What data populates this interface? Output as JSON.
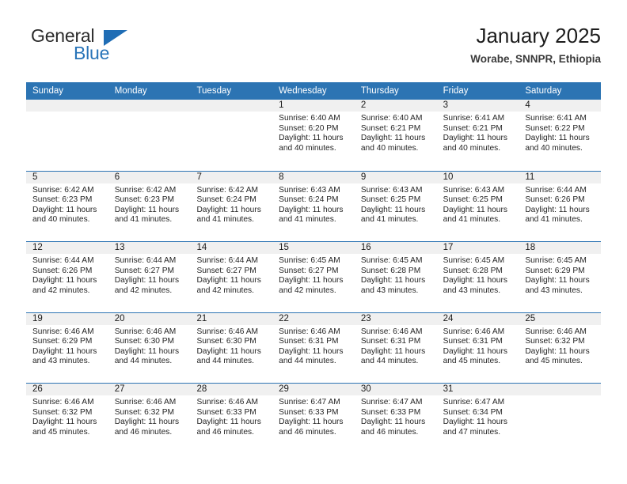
{
  "brand": {
    "name_part1": "General",
    "name_part2": "Blue",
    "flag_icon": "triangle-flag-icon"
  },
  "header": {
    "title": "January 2025",
    "subtitle": "Worabe, SNNPR, Ethiopia"
  },
  "colors": {
    "header_blue": "#2c74b3",
    "brand_blue": "#2874b8",
    "shade_gray": "#f0f0f0"
  },
  "calendar": {
    "weekdays": [
      "Sunday",
      "Monday",
      "Tuesday",
      "Wednesday",
      "Thursday",
      "Friday",
      "Saturday"
    ],
    "weeks": [
      {
        "shaded": true,
        "days": [
          {
            "num": "",
            "sunrise": "",
            "sunset": "",
            "daylight1": "",
            "daylight2": ""
          },
          {
            "num": "",
            "sunrise": "",
            "sunset": "",
            "daylight1": "",
            "daylight2": ""
          },
          {
            "num": "",
            "sunrise": "",
            "sunset": "",
            "daylight1": "",
            "daylight2": ""
          },
          {
            "num": "1",
            "sunrise": "Sunrise: 6:40 AM",
            "sunset": "Sunset: 6:20 PM",
            "daylight1": "Daylight: 11 hours",
            "daylight2": "and 40 minutes."
          },
          {
            "num": "2",
            "sunrise": "Sunrise: 6:40 AM",
            "sunset": "Sunset: 6:21 PM",
            "daylight1": "Daylight: 11 hours",
            "daylight2": "and 40 minutes."
          },
          {
            "num": "3",
            "sunrise": "Sunrise: 6:41 AM",
            "sunset": "Sunset: 6:21 PM",
            "daylight1": "Daylight: 11 hours",
            "daylight2": "and 40 minutes."
          },
          {
            "num": "4",
            "sunrise": "Sunrise: 6:41 AM",
            "sunset": "Sunset: 6:22 PM",
            "daylight1": "Daylight: 11 hours",
            "daylight2": "and 40 minutes."
          }
        ]
      },
      {
        "shaded": true,
        "days": [
          {
            "num": "5",
            "sunrise": "Sunrise: 6:42 AM",
            "sunset": "Sunset: 6:23 PM",
            "daylight1": "Daylight: 11 hours",
            "daylight2": "and 40 minutes."
          },
          {
            "num": "6",
            "sunrise": "Sunrise: 6:42 AM",
            "sunset": "Sunset: 6:23 PM",
            "daylight1": "Daylight: 11 hours",
            "daylight2": "and 41 minutes."
          },
          {
            "num": "7",
            "sunrise": "Sunrise: 6:42 AM",
            "sunset": "Sunset: 6:24 PM",
            "daylight1": "Daylight: 11 hours",
            "daylight2": "and 41 minutes."
          },
          {
            "num": "8",
            "sunrise": "Sunrise: 6:43 AM",
            "sunset": "Sunset: 6:24 PM",
            "daylight1": "Daylight: 11 hours",
            "daylight2": "and 41 minutes."
          },
          {
            "num": "9",
            "sunrise": "Sunrise: 6:43 AM",
            "sunset": "Sunset: 6:25 PM",
            "daylight1": "Daylight: 11 hours",
            "daylight2": "and 41 minutes."
          },
          {
            "num": "10",
            "sunrise": "Sunrise: 6:43 AM",
            "sunset": "Sunset: 6:25 PM",
            "daylight1": "Daylight: 11 hours",
            "daylight2": "and 41 minutes."
          },
          {
            "num": "11",
            "sunrise": "Sunrise: 6:44 AM",
            "sunset": "Sunset: 6:26 PM",
            "daylight1": "Daylight: 11 hours",
            "daylight2": "and 41 minutes."
          }
        ]
      },
      {
        "shaded": true,
        "days": [
          {
            "num": "12",
            "sunrise": "Sunrise: 6:44 AM",
            "sunset": "Sunset: 6:26 PM",
            "daylight1": "Daylight: 11 hours",
            "daylight2": "and 42 minutes."
          },
          {
            "num": "13",
            "sunrise": "Sunrise: 6:44 AM",
            "sunset": "Sunset: 6:27 PM",
            "daylight1": "Daylight: 11 hours",
            "daylight2": "and 42 minutes."
          },
          {
            "num": "14",
            "sunrise": "Sunrise: 6:44 AM",
            "sunset": "Sunset: 6:27 PM",
            "daylight1": "Daylight: 11 hours",
            "daylight2": "and 42 minutes."
          },
          {
            "num": "15",
            "sunrise": "Sunrise: 6:45 AM",
            "sunset": "Sunset: 6:27 PM",
            "daylight1": "Daylight: 11 hours",
            "daylight2": "and 42 minutes."
          },
          {
            "num": "16",
            "sunrise": "Sunrise: 6:45 AM",
            "sunset": "Sunset: 6:28 PM",
            "daylight1": "Daylight: 11 hours",
            "daylight2": "and 43 minutes."
          },
          {
            "num": "17",
            "sunrise": "Sunrise: 6:45 AM",
            "sunset": "Sunset: 6:28 PM",
            "daylight1": "Daylight: 11 hours",
            "daylight2": "and 43 minutes."
          },
          {
            "num": "18",
            "sunrise": "Sunrise: 6:45 AM",
            "sunset": "Sunset: 6:29 PM",
            "daylight1": "Daylight: 11 hours",
            "daylight2": "and 43 minutes."
          }
        ]
      },
      {
        "shaded": true,
        "days": [
          {
            "num": "19",
            "sunrise": "Sunrise: 6:46 AM",
            "sunset": "Sunset: 6:29 PM",
            "daylight1": "Daylight: 11 hours",
            "daylight2": "and 43 minutes."
          },
          {
            "num": "20",
            "sunrise": "Sunrise: 6:46 AM",
            "sunset": "Sunset: 6:30 PM",
            "daylight1": "Daylight: 11 hours",
            "daylight2": "and 44 minutes."
          },
          {
            "num": "21",
            "sunrise": "Sunrise: 6:46 AM",
            "sunset": "Sunset: 6:30 PM",
            "daylight1": "Daylight: 11 hours",
            "daylight2": "and 44 minutes."
          },
          {
            "num": "22",
            "sunrise": "Sunrise: 6:46 AM",
            "sunset": "Sunset: 6:31 PM",
            "daylight1": "Daylight: 11 hours",
            "daylight2": "and 44 minutes."
          },
          {
            "num": "23",
            "sunrise": "Sunrise: 6:46 AM",
            "sunset": "Sunset: 6:31 PM",
            "daylight1": "Daylight: 11 hours",
            "daylight2": "and 44 minutes."
          },
          {
            "num": "24",
            "sunrise": "Sunrise: 6:46 AM",
            "sunset": "Sunset: 6:31 PM",
            "daylight1": "Daylight: 11 hours",
            "daylight2": "and 45 minutes."
          },
          {
            "num": "25",
            "sunrise": "Sunrise: 6:46 AM",
            "sunset": "Sunset: 6:32 PM",
            "daylight1": "Daylight: 11 hours",
            "daylight2": "and 45 minutes."
          }
        ]
      },
      {
        "shaded": true,
        "days": [
          {
            "num": "26",
            "sunrise": "Sunrise: 6:46 AM",
            "sunset": "Sunset: 6:32 PM",
            "daylight1": "Daylight: 11 hours",
            "daylight2": "and 45 minutes."
          },
          {
            "num": "27",
            "sunrise": "Sunrise: 6:46 AM",
            "sunset": "Sunset: 6:32 PM",
            "daylight1": "Daylight: 11 hours",
            "daylight2": "and 46 minutes."
          },
          {
            "num": "28",
            "sunrise": "Sunrise: 6:46 AM",
            "sunset": "Sunset: 6:33 PM",
            "daylight1": "Daylight: 11 hours",
            "daylight2": "and 46 minutes."
          },
          {
            "num": "29",
            "sunrise": "Sunrise: 6:47 AM",
            "sunset": "Sunset: 6:33 PM",
            "daylight1": "Daylight: 11 hours",
            "daylight2": "and 46 minutes."
          },
          {
            "num": "30",
            "sunrise": "Sunrise: 6:47 AM",
            "sunset": "Sunset: 6:33 PM",
            "daylight1": "Daylight: 11 hours",
            "daylight2": "and 46 minutes."
          },
          {
            "num": "31",
            "sunrise": "Sunrise: 6:47 AM",
            "sunset": "Sunset: 6:34 PM",
            "daylight1": "Daylight: 11 hours",
            "daylight2": "and 47 minutes."
          },
          {
            "num": "",
            "sunrise": "",
            "sunset": "",
            "daylight1": "",
            "daylight2": ""
          }
        ]
      }
    ]
  }
}
